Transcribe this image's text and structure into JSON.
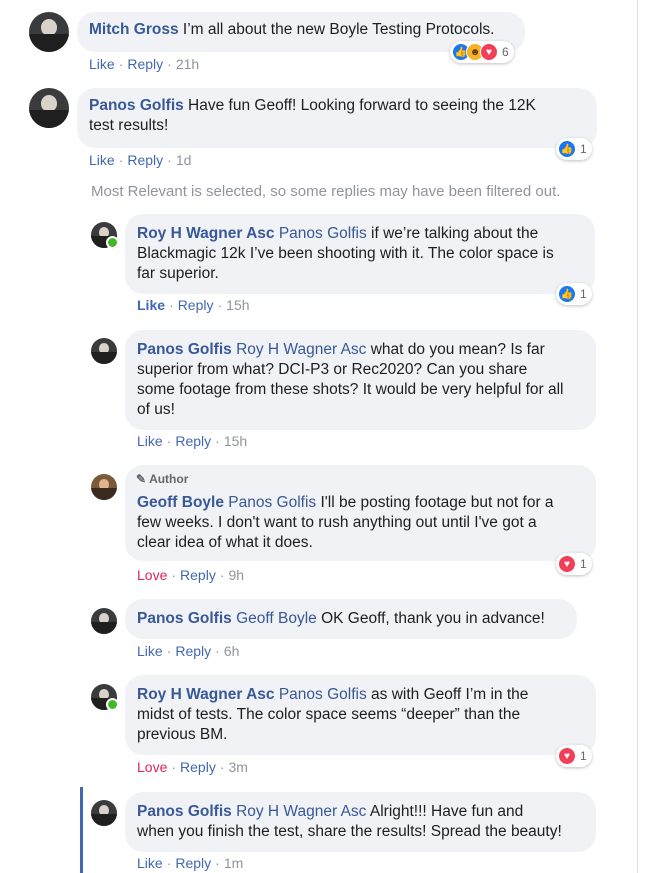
{
  "comments": [
    {
      "name": "Mitch Gross",
      "text": " I’m all about the new Boyle Testing Protocols.",
      "actions": [
        "Like",
        "Reply"
      ],
      "time": "21h",
      "reactions": {
        "icons": [
          "like-icon",
          "haha-icon",
          "love-icon"
        ],
        "count": "6"
      }
    },
    {
      "name": "Panos Golfis",
      "text_line1": " Have fun Geoff! Looking forward to seeing the 12K",
      "text_line2": "test results!",
      "actions": [
        "Like",
        "Reply"
      ],
      "time": "1d",
      "reactions": {
        "icons": [
          "like-icon"
        ],
        "count": "1"
      }
    }
  ],
  "filter_note": "Most Relevant is selected, so some replies may have been filtered out.",
  "replies": [
    {
      "name": "Roy H Wagner Asc",
      "tag": "Panos Golfis",
      "lines": [
        " if we’re talking about the",
        "Blackmagic 12k I’ve been shooting with it. The color space is",
        "far superior."
      ],
      "actions": [
        "Like",
        "Reply"
      ],
      "time": "15h",
      "reactions": {
        "icons": [
          "like-icon"
        ],
        "count": "1"
      }
    },
    {
      "name": "Panos Golfis",
      "tag": "Roy H Wagner Asc",
      "lines": [
        " what do you mean? Is far",
        "superior from what? DCI-P3 or Rec2020? Can you share",
        "some footage from these shots? It would be very helpful for all",
        "of us!"
      ],
      "actions": [
        "Like",
        "Reply"
      ],
      "time": "15h"
    },
    {
      "badge": "Author",
      "name": "Geoff Boyle",
      "tag": "Panos Golfis",
      "lines": [
        " I'll be posting footage but not for a",
        "few weeks. I don't want to rush anything out until I've got a",
        "clear idea of what it does."
      ],
      "actions": [
        "Love",
        "Reply"
      ],
      "time": "9h",
      "reactions": {
        "icons": [
          "love-icon"
        ],
        "count": "1"
      }
    },
    {
      "name": "Panos Golfis",
      "tag": "Geoff Boyle",
      "lines": [
        " OK Geoff, thank you in advance!"
      ],
      "actions": [
        "Like",
        "Reply"
      ],
      "time": "6h"
    },
    {
      "name": "Roy H Wagner Asc",
      "tag": "Panos Golfis",
      "lines": [
        " as with Geoff I’m in the",
        "midst of tests. The color space seems “deeper” than the",
        "previous BM."
      ],
      "actions": [
        "Love",
        "Reply"
      ],
      "time": "3m",
      "reactions": {
        "icons": [
          "love-icon"
        ],
        "count": "1"
      }
    },
    {
      "name": "Panos Golfis",
      "tag": "Roy H Wagner Asc",
      "lines": [
        " Alright!!! Have fun and",
        "when you finish the test, share the results! Spread the beauty!"
      ],
      "actions": [
        "Like",
        "Reply"
      ],
      "time": "1m"
    }
  ],
  "separator": "·",
  "colors": {
    "name": "#385898",
    "link": "#4267b2",
    "love": "#e0245e",
    "muted": "#90949c",
    "bubble": "#f0f2f5"
  }
}
